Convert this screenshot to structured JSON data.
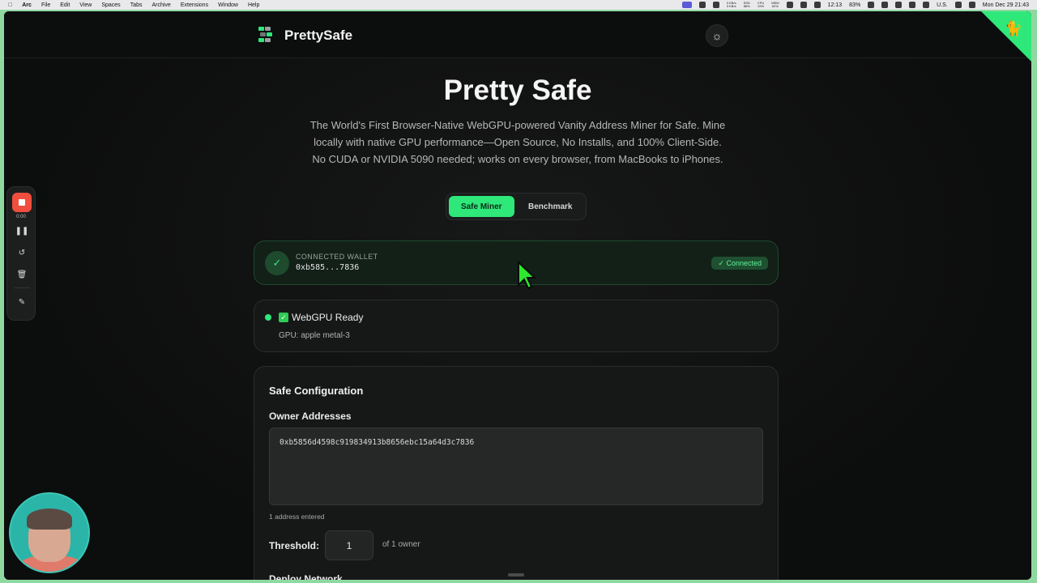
{
  "menubar": {
    "apple": "",
    "app": "Arc",
    "menus": [
      "File",
      "Edit",
      "View",
      "Spaces",
      "Tabs",
      "Archive",
      "Extensions",
      "Window",
      "Help"
    ],
    "stats": [
      {
        "top": "3 KB/s",
        "bottom": "3 KB/s"
      },
      {
        "top": "SSD",
        "bottom": "88%"
      },
      {
        "top": "CPU",
        "bottom": "19%"
      },
      {
        "top": "MEM",
        "bottom": "62%"
      }
    ],
    "clock_small": "12:13",
    "battery": "83%",
    "input_source": "U.S.",
    "datetime": "Mon Dec 29  21:43"
  },
  "header": {
    "brand": "PrettySafe",
    "theme_toggle_icon": "sun-icon",
    "corner_icon": "github-octocat-icon"
  },
  "hero": {
    "title": "Pretty Safe",
    "description": "The World's First Browser-Native WebGPU-powered Vanity Address Miner for Safe. Mine locally with native GPU performance—Open Source, No Installs, and 100% Client-Side. No CUDA or NVIDIA 5090 needed; works on every browser, from MacBooks to iPhones."
  },
  "tabs": [
    {
      "label": "Safe Miner",
      "active": true
    },
    {
      "label": "Benchmark",
      "active": false
    }
  ],
  "wallet": {
    "label": "CONNECTED WALLET",
    "address": "0xb585...7836",
    "badge": "✓ Connected"
  },
  "gpu": {
    "status": "WebGPU Ready",
    "detail": "GPU: apple metal-3"
  },
  "config": {
    "title": "Safe Configuration",
    "owners_label": "Owner Addresses",
    "owners_value": "0xb5856d4598c919834913b8656ebc15a64d3c7836",
    "owners_count": "1 address entered",
    "threshold_label": "Threshold:",
    "threshold_value": "1",
    "threshold_suffix": "of 1 owner",
    "deploy_label": "Deploy Network"
  },
  "recorder": {
    "time": "0:00"
  },
  "colors": {
    "accent": "#2ee87a",
    "background": "#0e0f0f",
    "card": "#161818",
    "record": "#f04e3e"
  }
}
